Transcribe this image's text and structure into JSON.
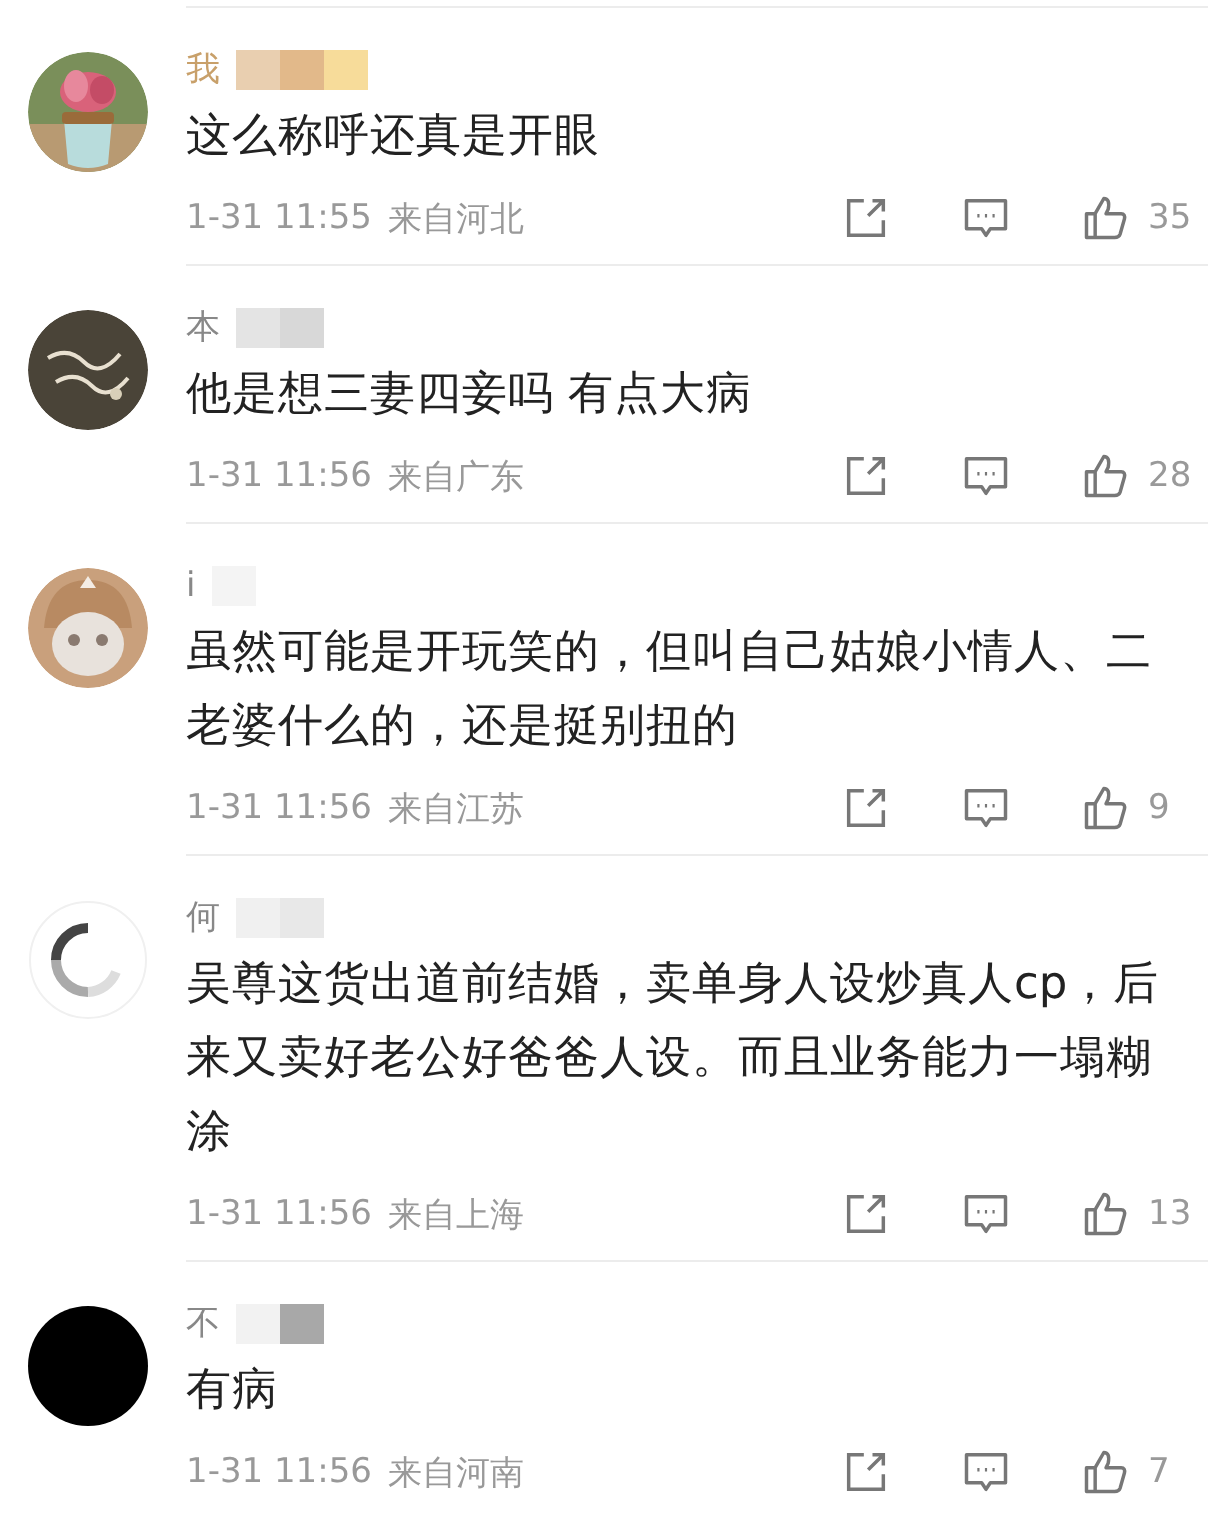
{
  "comments": [
    {
      "username": "我",
      "kind": "flower",
      "text": "这么称呼还真是开眼",
      "time": "1-31 11:55",
      "location": "来自河北",
      "likes": "35"
    },
    {
      "username": "本",
      "kind": "calligraphy",
      "text": "他是想三妻四妾吗 有点大病",
      "time": "1-31 11:56",
      "location": "来自广东",
      "likes": "28"
    },
    {
      "username": "i",
      "kind": "cat",
      "text": "虽然可能是开玩笑的，但叫自己姑娘小情人、二老婆什么的，还是挺别扭的",
      "time": "1-31 11:56",
      "location": "来自江苏",
      "likes": "9"
    },
    {
      "username": "何",
      "kind": "spinner",
      "text": "吴尊这货出道前结婚，卖单身人设炒真人cp，后来又卖好老公好爸爸人设。而且业务能力一塌糊涂",
      "time": "1-31 11:56",
      "location": "来自上海",
      "likes": "13"
    },
    {
      "username": "不",
      "kind": "black",
      "text": "有病",
      "time": "1-31 11:56",
      "location": "来自河南",
      "likes": "7"
    }
  ]
}
